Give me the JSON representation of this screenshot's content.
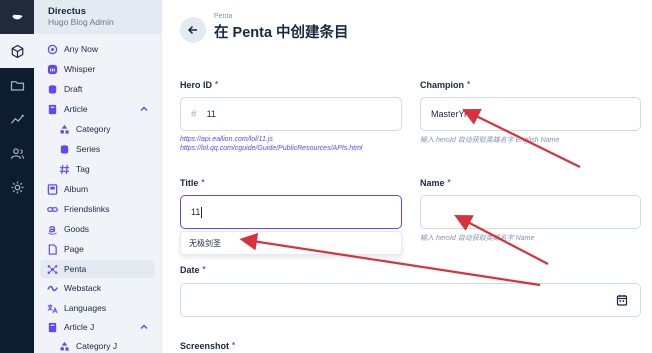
{
  "project": {
    "name": "Directus",
    "subtitle": "Hugo Blog Admin"
  },
  "modules": [
    {
      "icon": "cube-icon",
      "active": true
    },
    {
      "icon": "folder-icon",
      "active": false
    },
    {
      "icon": "insights-icon",
      "active": false
    },
    {
      "icon": "users-icon",
      "active": false
    },
    {
      "icon": "settings-icon",
      "active": false
    }
  ],
  "nav": {
    "items": [
      {
        "label": "Any Now",
        "icon": "any-now-icon"
      },
      {
        "label": "Whisper",
        "icon": "mastodon-icon"
      },
      {
        "label": "Draft",
        "icon": "database-icon"
      },
      {
        "label": "Article",
        "icon": "book-icon"
      },
      {
        "label": "Category",
        "icon": "category-icon"
      },
      {
        "label": "Series",
        "icon": "database-icon"
      },
      {
        "label": "Tag",
        "icon": "hash-icon"
      },
      {
        "label": "Album",
        "icon": "album-icon"
      },
      {
        "label": "Friendslinks",
        "icon": "link-icon"
      },
      {
        "label": "Goods",
        "icon": "amazon-icon"
      },
      {
        "label": "Page",
        "icon": "page-icon"
      },
      {
        "label": "Penta",
        "icon": "hub-icon"
      },
      {
        "label": "Webstack",
        "icon": "stack-icon"
      },
      {
        "label": "Languages",
        "icon": "translate-icon"
      },
      {
        "label": "Article J",
        "icon": "book-icon"
      },
      {
        "label": "Category J",
        "icon": "category-icon"
      }
    ]
  },
  "header": {
    "breadcrumb": "Penta",
    "title": "在 Penta 中创建条目"
  },
  "fields": {
    "hero_id": {
      "label": "Hero ID",
      "required": "*",
      "value": "11",
      "hint_line1": "https://api.eallion.com/lol/11.js",
      "hint_line2": "https://lol.qq.com/cguide/Guide/PublicResources/APIs.html"
    },
    "champion": {
      "label": "Champion",
      "required": "*",
      "value": "MasterYi",
      "hint": "输入 heroId 自动获取英雄名字 English Name"
    },
    "title": {
      "label": "Title",
      "required": "*",
      "value": "11",
      "suggestion": "无极剑圣"
    },
    "name": {
      "label": "Name",
      "required": "*",
      "value": "",
      "hint": "输入 heroId 自动获取英雄名字 Name"
    },
    "date": {
      "label": "Date",
      "required": "*",
      "value": ""
    },
    "screenshot": {
      "label": "Screenshot",
      "required": "*"
    }
  },
  "colors": {
    "accent": "#6644ff",
    "annotation_arrow": "#d9323a",
    "module_bar": "#0e1c2f",
    "nav_bg": "#f0f4f9"
  }
}
